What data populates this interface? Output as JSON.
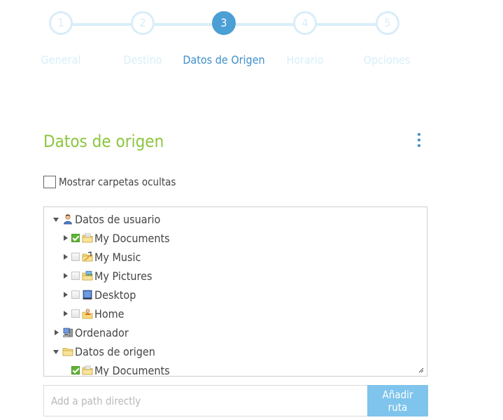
{
  "stepper": {
    "steps": [
      {
        "number": "1",
        "label": "General"
      },
      {
        "number": "2",
        "label": "Destino"
      },
      {
        "number": "3",
        "label": "Datos de Origen"
      },
      {
        "number": "4",
        "label": "Horario"
      },
      {
        "number": "5",
        "label": "Opciones"
      }
    ],
    "active_step": 3
  },
  "section": {
    "title": "Datos de origen",
    "show_hidden_label": "Mostrar carpetas ocultas",
    "show_hidden_checked": false
  },
  "tree": {
    "items": [
      {
        "label": "Datos de usuario",
        "icon": "user-icon",
        "expanded": true,
        "checkbox": null
      },
      {
        "label": "My Documents",
        "icon": "documents-folder-icon",
        "expanded": false,
        "checkbox": "checked"
      },
      {
        "label": "My Music",
        "icon": "music-folder-icon",
        "expanded": false,
        "checkbox": "unchecked"
      },
      {
        "label": "My Pictures",
        "icon": "pictures-folder-icon",
        "expanded": false,
        "checkbox": "unchecked"
      },
      {
        "label": "Desktop",
        "icon": "desktop-icon",
        "expanded": false,
        "checkbox": "unchecked"
      },
      {
        "label": "Home",
        "icon": "home-folder-icon",
        "expanded": false,
        "checkbox": "unchecked"
      },
      {
        "label": "Ordenador",
        "icon": "computer-icon",
        "expanded": false,
        "checkbox": null
      },
      {
        "label": "Datos de origen",
        "icon": "folder-icon",
        "expanded": true,
        "checkbox": null
      },
      {
        "label": "My Documents",
        "icon": "documents-folder-icon",
        "expanded": null,
        "checkbox": "checked"
      }
    ]
  },
  "path_input": {
    "placeholder": "Add a path directly",
    "value": "",
    "button_label": "Añadir ruta"
  },
  "colors": {
    "accent_blue": "#4a9fd4",
    "step_inactive": "#d8eef9",
    "title_green": "#8cc63f",
    "button_blue": "#7fc4ec"
  }
}
